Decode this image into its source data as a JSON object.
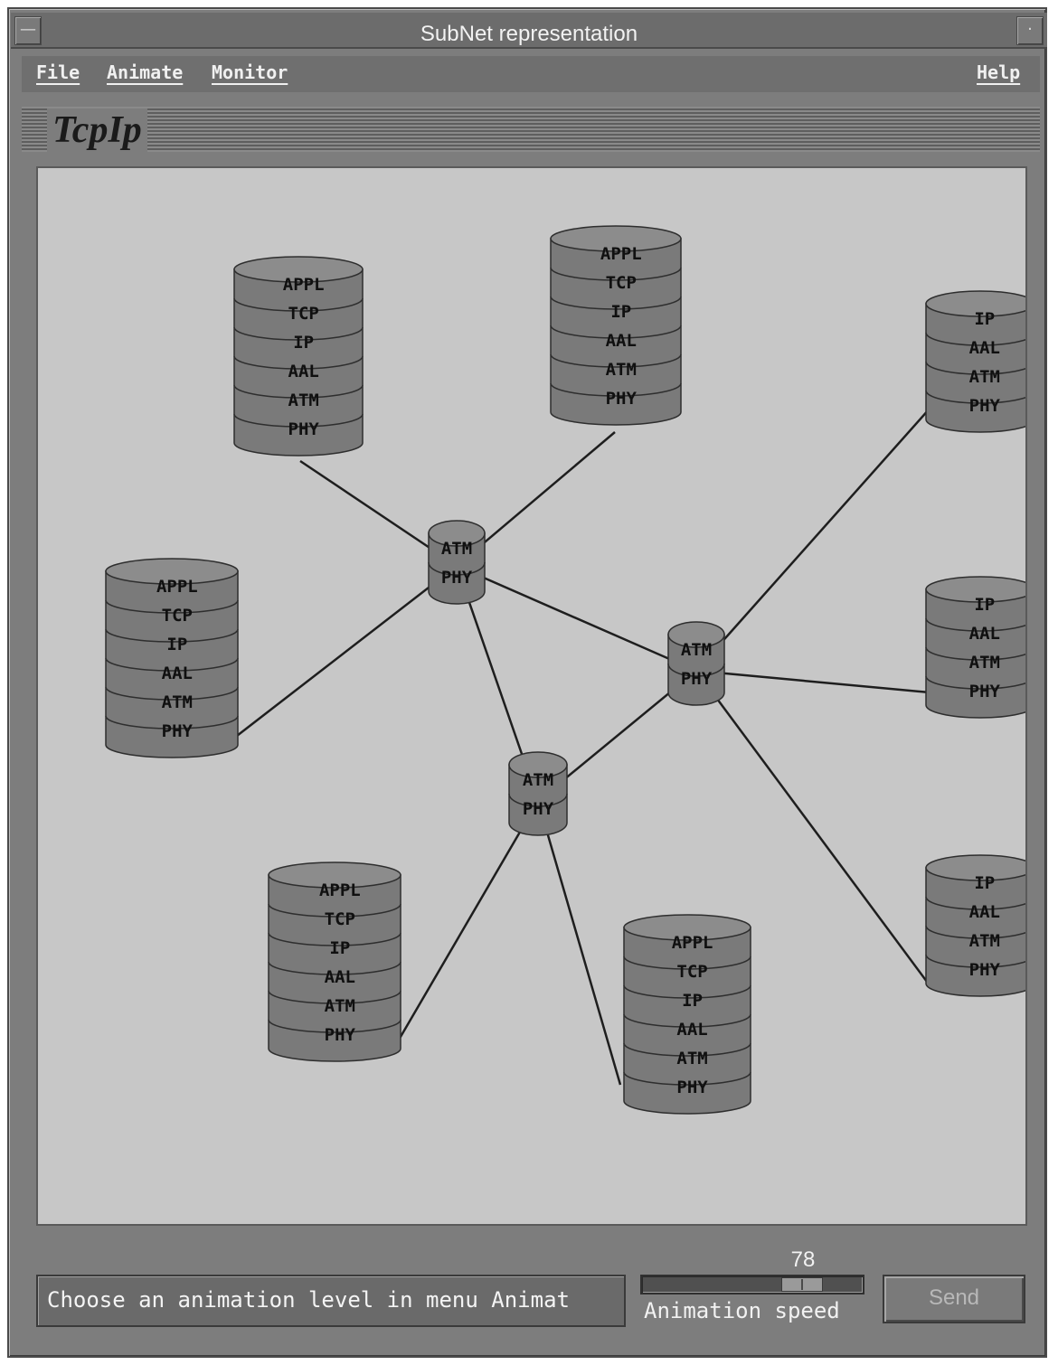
{
  "window": {
    "title": "SubNet representation"
  },
  "menubar": {
    "file": "File",
    "animate": "Animate",
    "monitor": "Monitor",
    "help": "Help"
  },
  "panel": {
    "title": "TcpIp"
  },
  "network": {
    "hosts": [
      {
        "id": "host-1",
        "layers": [
          "APPL",
          "TCP",
          "IP",
          "AAL",
          "ATM",
          "PHY"
        ]
      },
      {
        "id": "host-2",
        "layers": [
          "APPL",
          "TCP",
          "IP",
          "AAL",
          "ATM",
          "PHY"
        ]
      },
      {
        "id": "host-3",
        "layers": [
          "APPL",
          "TCP",
          "IP",
          "AAL",
          "ATM",
          "PHY"
        ]
      },
      {
        "id": "host-4",
        "layers": [
          "APPL",
          "TCP",
          "IP",
          "AAL",
          "ATM",
          "PHY"
        ]
      },
      {
        "id": "host-5",
        "layers": [
          "APPL",
          "TCP",
          "IP",
          "AAL",
          "ATM",
          "PHY"
        ]
      },
      {
        "id": "router-1",
        "layers": [
          "IP",
          "AAL",
          "ATM",
          "PHY"
        ]
      },
      {
        "id": "router-2",
        "layers": [
          "IP",
          "AAL",
          "ATM",
          "PHY"
        ]
      },
      {
        "id": "router-3",
        "layers": [
          "IP",
          "AAL",
          "ATM",
          "PHY"
        ]
      }
    ],
    "switches": [
      {
        "id": "switch-1",
        "layers": [
          "ATM",
          "PHY"
        ]
      },
      {
        "id": "switch-2",
        "layers": [
          "ATM",
          "PHY"
        ]
      },
      {
        "id": "switch-3",
        "layers": [
          "ATM",
          "PHY"
        ]
      }
    ],
    "links": [
      [
        "host-1",
        "switch-1"
      ],
      [
        "host-2",
        "switch-1"
      ],
      [
        "host-3",
        "switch-1"
      ],
      [
        "switch-1",
        "switch-2"
      ],
      [
        "switch-1",
        "switch-3"
      ],
      [
        "switch-3",
        "switch-2"
      ],
      [
        "switch-2",
        "router-1"
      ],
      [
        "switch-2",
        "router-2"
      ],
      [
        "switch-2",
        "router-3"
      ],
      [
        "host-4",
        "switch-3"
      ],
      [
        "host-5",
        "switch-3"
      ]
    ]
  },
  "statusbar": {
    "message": "Choose an animation level in menu Animat",
    "speed_value": "78",
    "speed_fraction": 0.78,
    "speed_label": "Animation speed",
    "send_label": "Send"
  },
  "colors": {
    "canvas": "#c7c7c7",
    "cylinder_body": "#7a7a7a",
    "cylinder_top": "#8c8c8c",
    "link": "#1e1e1e"
  }
}
